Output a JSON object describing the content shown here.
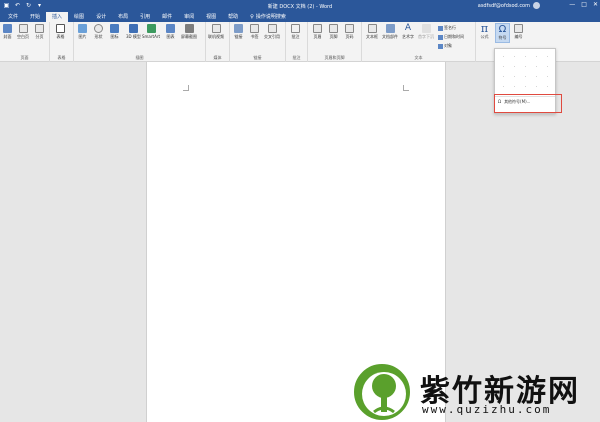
{
  "window": {
    "title": "新建 DOCX 文档 (2) - Word",
    "user": "asdfsdf@ofdsod.com",
    "qat_icons": [
      "save-icon",
      "undo-icon",
      "redo-icon",
      "customize-icon"
    ],
    "controls": [
      "—",
      "□",
      "✕"
    ]
  },
  "tabs": [
    {
      "label": "文件"
    },
    {
      "label": "开始"
    },
    {
      "label": "插入",
      "active": true
    },
    {
      "label": "绘图"
    },
    {
      "label": "设计"
    },
    {
      "label": "布局"
    },
    {
      "label": "引用"
    },
    {
      "label": "邮件"
    },
    {
      "label": "审阅"
    },
    {
      "label": "视图"
    },
    {
      "label": "帮助"
    }
  ],
  "tell_me": "操作说明搜索",
  "ribbon": {
    "pages_group": {
      "label": "页面",
      "buttons": [
        "封面",
        "空白页",
        "分页"
      ]
    },
    "tables_group": {
      "label": "表格",
      "buttons": [
        "表格"
      ]
    },
    "illustrations_group": {
      "label": "插图",
      "buttons": [
        "图片",
        "形状",
        "图标",
        "3D 模型",
        "SmartArt",
        "图表",
        "屏幕截图"
      ]
    },
    "media_group": {
      "label": "媒体",
      "buttons": [
        "联机视频"
      ]
    },
    "links_group": {
      "label": "链接",
      "buttons": [
        "链接",
        "书签",
        "交叉引用"
      ]
    },
    "comments_group": {
      "label": "批注",
      "buttons": [
        "批注"
      ]
    },
    "header_footer_group": {
      "label": "页眉和页脚",
      "buttons": [
        "页眉",
        "页脚",
        "页码"
      ]
    },
    "text_group": {
      "label": "文本",
      "buttons": [
        "文本框",
        "文档部件",
        "艺术字",
        "首字下沉"
      ],
      "small": [
        "签名行",
        "日期和时间",
        "对象"
      ]
    },
    "symbols_group": {
      "buttons": [
        "公式",
        "符号",
        "编号"
      ]
    }
  },
  "symbols_dropdown": {
    "grid": [
      "·",
      "·",
      "·",
      "·",
      "·",
      "·",
      "·",
      "·",
      "·",
      "·",
      "·",
      "·",
      "·",
      "·",
      "·",
      "·",
      "·",
      "·",
      "·",
      "·"
    ],
    "more_label": "其他符号(M)..."
  },
  "watermark": {
    "title": "紫竹新游网",
    "url": "www.quzizhu.com"
  },
  "colors": {
    "brand": "#2b579a",
    "highlight": "#e04a3f",
    "logo_green": "#5aa02c"
  }
}
